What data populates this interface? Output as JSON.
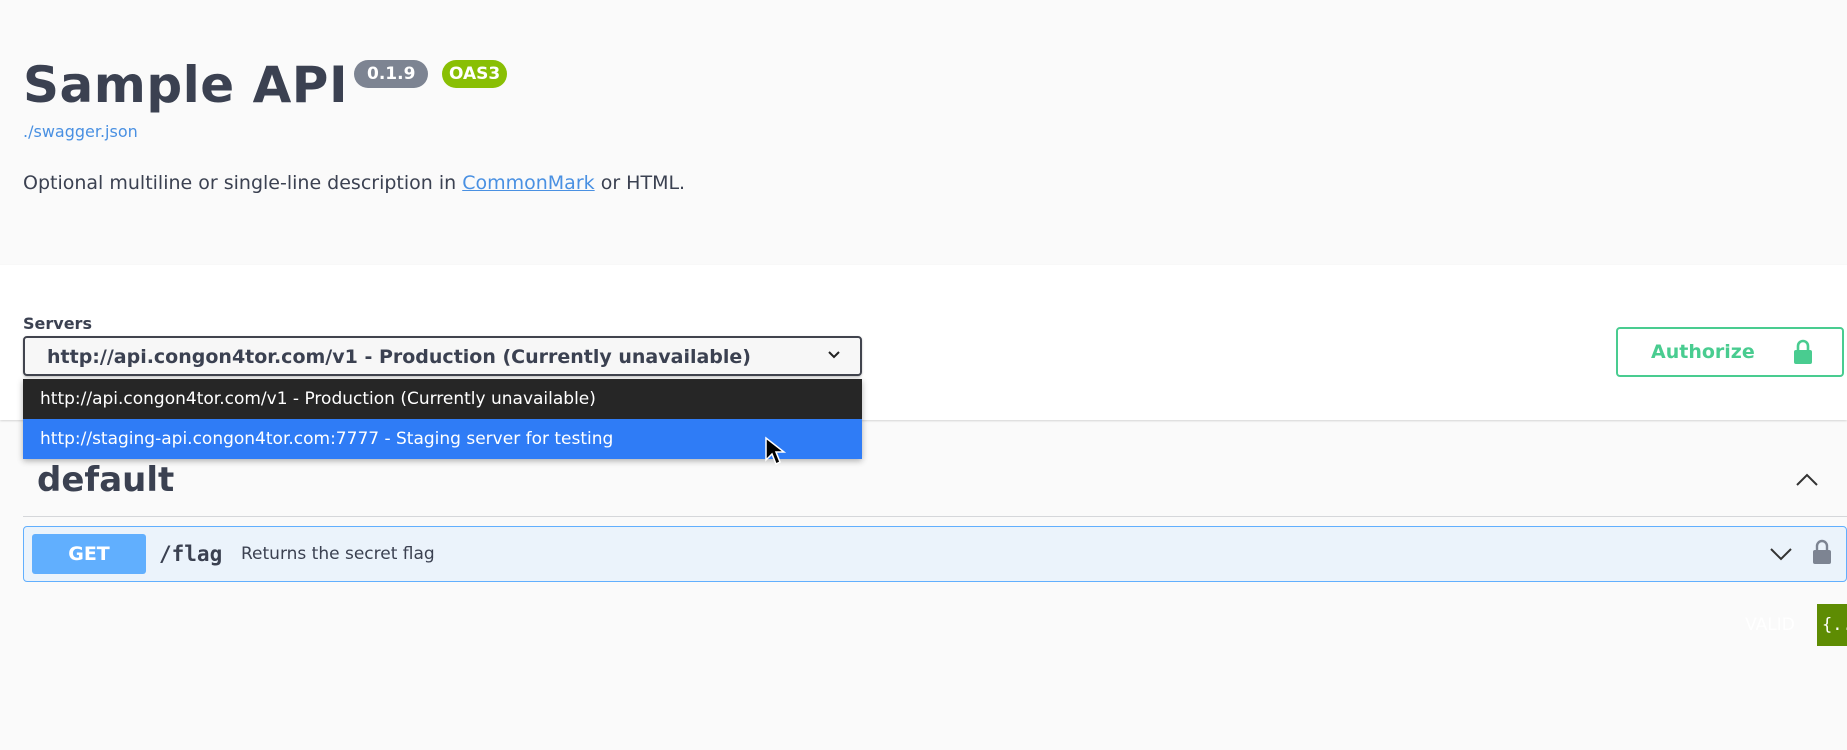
{
  "info": {
    "title": "Sample API",
    "version": "0.1.9",
    "oas_badge": "OAS3",
    "spec_link": "./swagger.json",
    "description_before": "Optional multiline or single-line description in ",
    "description_link": "CommonMark",
    "description_after": " or HTML."
  },
  "servers": {
    "label": "Servers",
    "selected": "http://api.congon4tor.com/v1 - Production (Currently unavailable)",
    "options": [
      "http://api.congon4tor.com/v1 - Production (Currently unavailable)",
      "http://staging-api.congon4tor.com:7777 - Staging server for testing"
    ],
    "highlighted_index": 1
  },
  "authorize": {
    "label": "Authorize",
    "icon": "lock-icon"
  },
  "tag": {
    "name": "default",
    "toggle_icon": "chevron-up-icon",
    "operations": [
      {
        "method": "GET",
        "path": "/flag",
        "summary": "Returns the secret flag",
        "chevron_icon": "chevron-down-icon",
        "lock_icon": "lock-icon"
      }
    ]
  },
  "validator": {
    "label": "VALID",
    "icon_text": "{..."
  },
  "colors": {
    "get": "#61affe",
    "authorize": "#49cc90",
    "valid": "#89bf04",
    "dropdown_highlight": "#2f7cf6"
  }
}
